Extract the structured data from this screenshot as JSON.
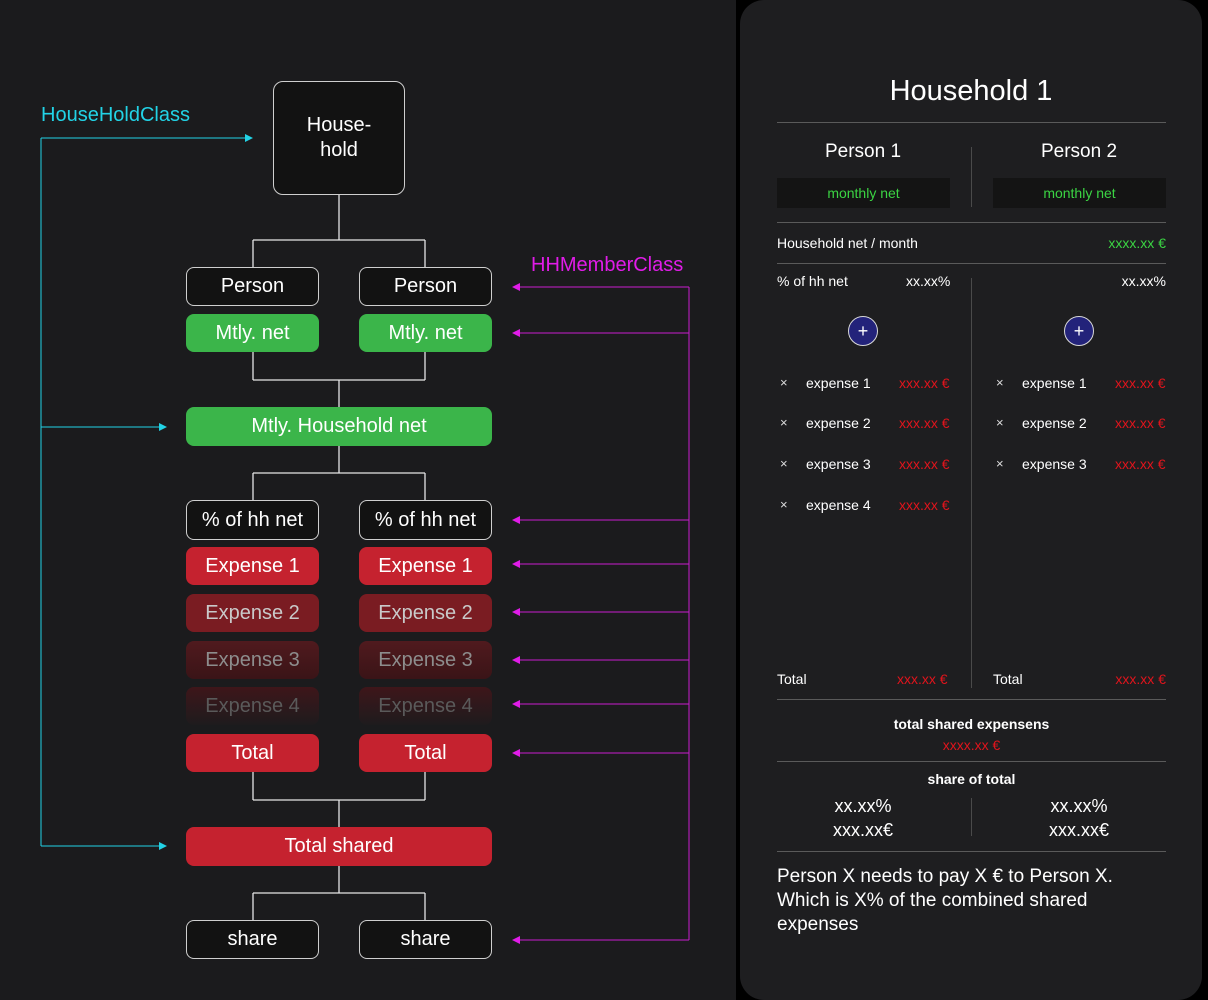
{
  "diagram": {
    "household_class_label": "HouseHoldClass",
    "member_class_label": "HHMemberClass",
    "household_box": "House-\nhold",
    "person_label": "Person",
    "monthly_net_label": "Mtly. net",
    "household_net_label": "Mtly. Household net",
    "pct_label": "% of hh net",
    "expenses": [
      "Expense 1",
      "Expense 2",
      "Expense 3",
      "Expense 4"
    ],
    "total_label": "Total",
    "total_shared_label": "Total shared",
    "share_label": "share",
    "colors": {
      "cyan": "#22d3e6",
      "magenta": "#e01ce8",
      "green": "#3bb54a",
      "red": "#c5222f"
    }
  },
  "phone": {
    "title": "Household 1",
    "persons": [
      {
        "name": "Person 1",
        "net_placeholder": "monthly net",
        "pct": "xx.xx%",
        "expenses": [
          {
            "name": "expense 1",
            "value": "xxx.xx €"
          },
          {
            "name": "expense 2",
            "value": "xxx.xx €"
          },
          {
            "name": "expense 3",
            "value": "xxx.xx €"
          },
          {
            "name": "expense 4",
            "value": "xxx.xx €"
          }
        ],
        "total_label": "Total",
        "total_value": "xxx.xx €",
        "share_pct": "xx.xx%",
        "share_amount": "xxx.xx€"
      },
      {
        "name": "Person 2",
        "net_placeholder": "monthly net",
        "pct": "xx.xx%",
        "expenses": [
          {
            "name": "expense 1",
            "value": "xxx.xx €"
          },
          {
            "name": "expense 2",
            "value": "xxx.xx €"
          },
          {
            "name": "expense 3",
            "value": "xxx.xx €"
          }
        ],
        "total_label": "Total",
        "total_value": "xxx.xx €",
        "share_pct": "xx.xx%",
        "share_amount": "xxx.xx€"
      }
    ],
    "household_net_label": "Household net / month",
    "household_net_value": "xxxx.xx €",
    "pct_label": "% of hh net",
    "add_icon": "+",
    "remove_icon": "×",
    "total_shared_label": "total shared expensens",
    "total_shared_value": "xxxx.xx €",
    "share_of_total_label": "share of total",
    "summary": "Person X needs to pay X € to Person X. Which is X% of the combined shared expenses"
  }
}
